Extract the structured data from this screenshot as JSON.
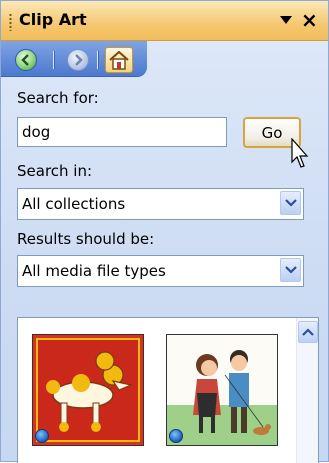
{
  "pane": {
    "title": "Clip Art"
  },
  "nav": {
    "back": "back-icon",
    "forward": "forward-icon",
    "home": "home-icon"
  },
  "search": {
    "label": "Search for:",
    "value": "dog",
    "go_label": "Go"
  },
  "search_in": {
    "label": "Search in:",
    "value": "All collections"
  },
  "results_type": {
    "label": "Results should be:",
    "value": "All media file types"
  },
  "results": {
    "items": [
      {
        "name": "poodle-clipart",
        "icon": "web-collection-globe-icon"
      },
      {
        "name": "couple-walking-dog-clipart",
        "icon": "web-collection-globe-icon"
      }
    ]
  },
  "colors": {
    "title_bar": "#f5c770",
    "nav_bar": "#4d79cf",
    "pane_bg": "#cddcf3",
    "go_border": "#d8a33e"
  }
}
